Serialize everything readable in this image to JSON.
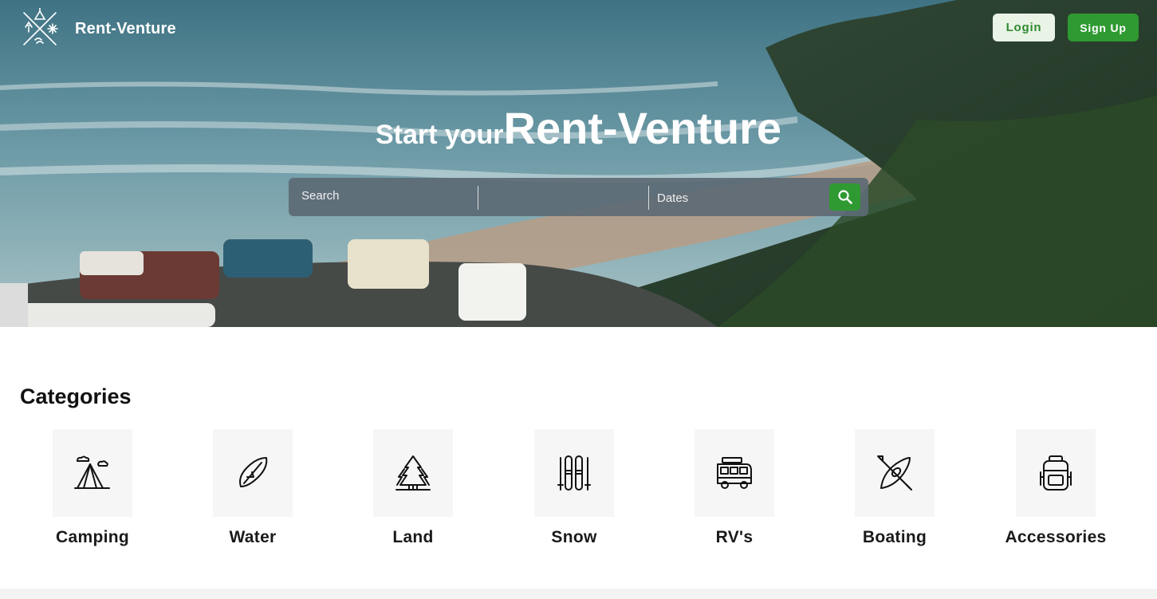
{
  "brand": {
    "name": "Rent-Venture",
    "logo_icon": "compass-camping-logo-icon"
  },
  "nav": {
    "login_label": "Login",
    "signup_label": "Sign Up"
  },
  "hero": {
    "title_small": "Start your",
    "title_big": "Rent-Venture",
    "search": {
      "search_placeholder": "Search",
      "location_placeholder": "",
      "dates_placeholder": "Dates",
      "button_icon": "search-icon"
    }
  },
  "categories": {
    "title": "Categories",
    "items": [
      {
        "label": "Camping",
        "icon": "tent-icon"
      },
      {
        "label": "Water",
        "icon": "surfboard-icon"
      },
      {
        "label": "Land",
        "icon": "pine-trees-icon"
      },
      {
        "label": "Snow",
        "icon": "skis-icon"
      },
      {
        "label": "RV's",
        "icon": "van-icon"
      },
      {
        "label": "Boating",
        "icon": "kayak-icon"
      },
      {
        "label": "Accessories",
        "icon": "backpack-icon"
      }
    ]
  },
  "colors": {
    "accent": "#2f9a32",
    "login_bg": "#e9f3e6",
    "searchbar_bg": "#5c6a74"
  }
}
